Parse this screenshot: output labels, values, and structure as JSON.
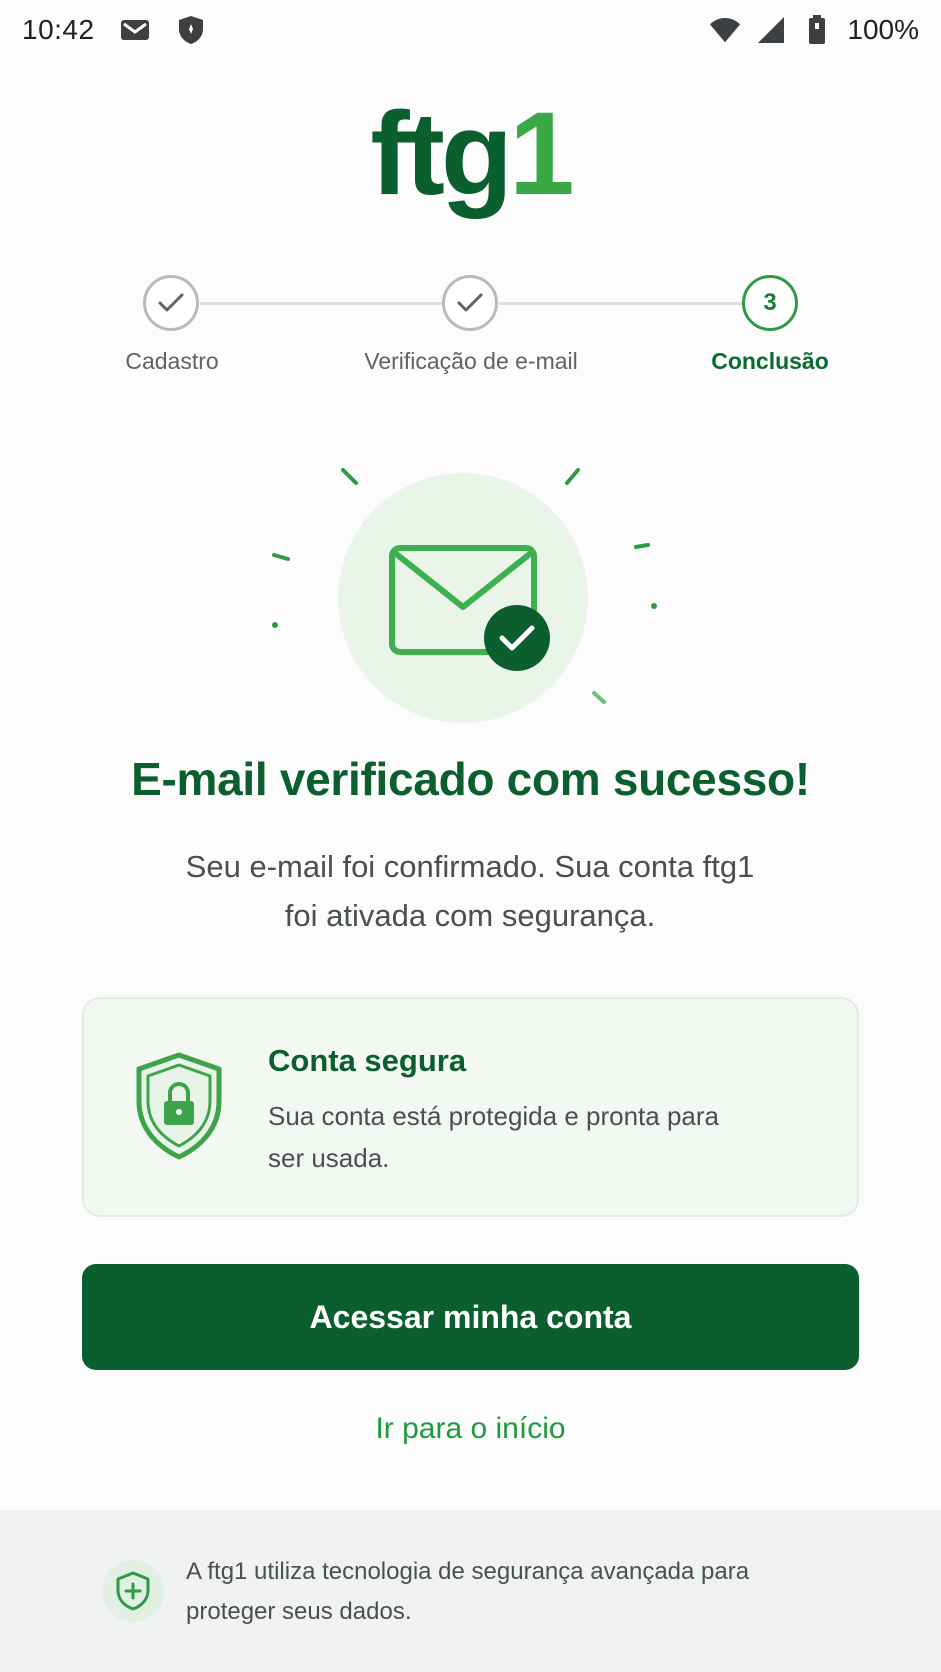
{
  "status_bar": {
    "time": "10:42",
    "battery": "100%",
    "icons": [
      "gmail-icon",
      "shield-icon",
      "wifi-icon",
      "signal-icon",
      "battery-icon"
    ]
  },
  "logo": {
    "main": "ftg",
    "accent": "1"
  },
  "stepper": {
    "steps": [
      {
        "label": "Cadastro",
        "state": "done"
      },
      {
        "label": "Verificação de e-mail",
        "state": "done"
      },
      {
        "label": "Conclusão",
        "number": "3",
        "state": "active"
      }
    ]
  },
  "hero": {
    "icon": "envelope-check-icon"
  },
  "headline": "E-mail verificado com sucesso!",
  "subtext": "Seu e-mail foi confirmado. Sua conta ftg1 foi ativada com segurança.",
  "card": {
    "icon": "shield-lock-icon",
    "title": "Conta segura",
    "body": "Sua conta está protegida e pronta para ser usada."
  },
  "actions": {
    "primary_label": "Acessar minha conta",
    "secondary_label": "Ir para o início"
  },
  "footer": {
    "icon": "shield-plus-icon",
    "text": "A ftg1 utiliza tecnologia de segurança avançada para proteger seus dados."
  },
  "colors": {
    "brand_dark": "#0b5e2e",
    "brand_light": "#3aa845",
    "link": "#1f9a3e"
  }
}
